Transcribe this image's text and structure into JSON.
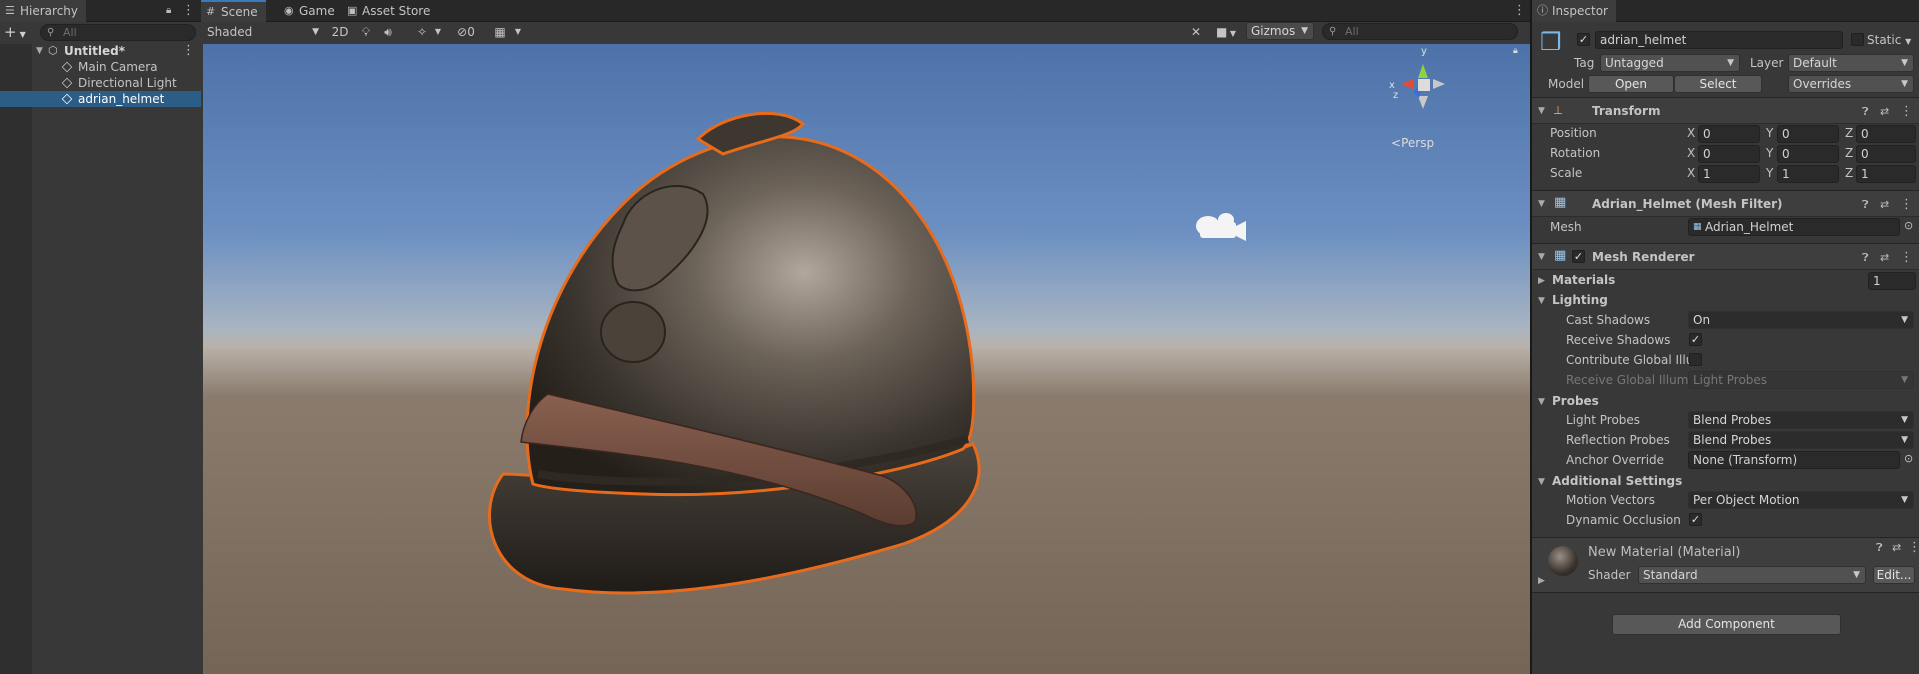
{
  "hierarchy": {
    "tab_label": "Hierarchy",
    "search_placeholder": "All",
    "add_label": "+",
    "scene_name": "Untitled*",
    "items": [
      {
        "label": "Main Camera"
      },
      {
        "label": "Directional Light"
      },
      {
        "label": "adrian_helmet"
      }
    ]
  },
  "scene_panel": {
    "tabs": [
      {
        "label": "Scene"
      },
      {
        "label": "Game"
      },
      {
        "label": "Asset Store"
      }
    ],
    "shading_mode": "Shaded",
    "mode_2d": "2D",
    "hidden_count": "0",
    "gizmos_label": "Gizmos",
    "search_placeholder": "All",
    "persp_label": "Persp",
    "gizmo_axes": {
      "y": "y",
      "x": "x",
      "z": "z"
    }
  },
  "inspector": {
    "tab_label": "Inspector",
    "object_name": "adrian_helmet",
    "static_label": "Static",
    "tag_label": "Tag",
    "tag_value": "Untagged",
    "layer_label": "Layer",
    "layer_value": "Default",
    "model_label": "Model",
    "open_label": "Open",
    "select_label": "Select",
    "overrides_label": "Overrides",
    "transform": {
      "title": "Transform",
      "position_label": "Position",
      "rotation_label": "Rotation",
      "scale_label": "Scale",
      "axis_x": "X",
      "axis_y": "Y",
      "axis_z": "Z",
      "position": [
        "0",
        "0",
        "0"
      ],
      "rotation": [
        "0",
        "0",
        "0"
      ],
      "scale": [
        "1",
        "1",
        "1"
      ]
    },
    "mesh_filter": {
      "title": "Adrian_Helmet (Mesh Filter)",
      "mesh_label": "Mesh",
      "mesh_value": "Adrian_Helmet"
    },
    "mesh_renderer": {
      "title": "Mesh Renderer",
      "materials_label": "Materials",
      "materials_count": "1",
      "lighting_label": "Lighting",
      "cast_shadows_label": "Cast Shadows",
      "cast_shadows_value": "On",
      "receive_shadows_label": "Receive Shadows",
      "contribute_gi_label": "Contribute Global Illu",
      "receive_gi_label": "Receive Global Illumi",
      "receive_gi_value": "Light Probes",
      "probes_label": "Probes",
      "light_probes_label": "Light Probes",
      "light_probes_value": "Blend Probes",
      "reflection_probes_label": "Reflection Probes",
      "reflection_probes_value": "Blend Probes",
      "anchor_override_label": "Anchor Override",
      "anchor_override_value": "None (Transform)",
      "additional_label": "Additional Settings",
      "motion_vectors_label": "Motion Vectors",
      "motion_vectors_value": "Per Object Motion",
      "dynamic_occlusion_label": "Dynamic Occlusion"
    },
    "material": {
      "title": "New Material (Material)",
      "shader_label": "Shader",
      "shader_value": "Standard",
      "edit_label": "Edit..."
    },
    "add_component_label": "Add Component"
  }
}
